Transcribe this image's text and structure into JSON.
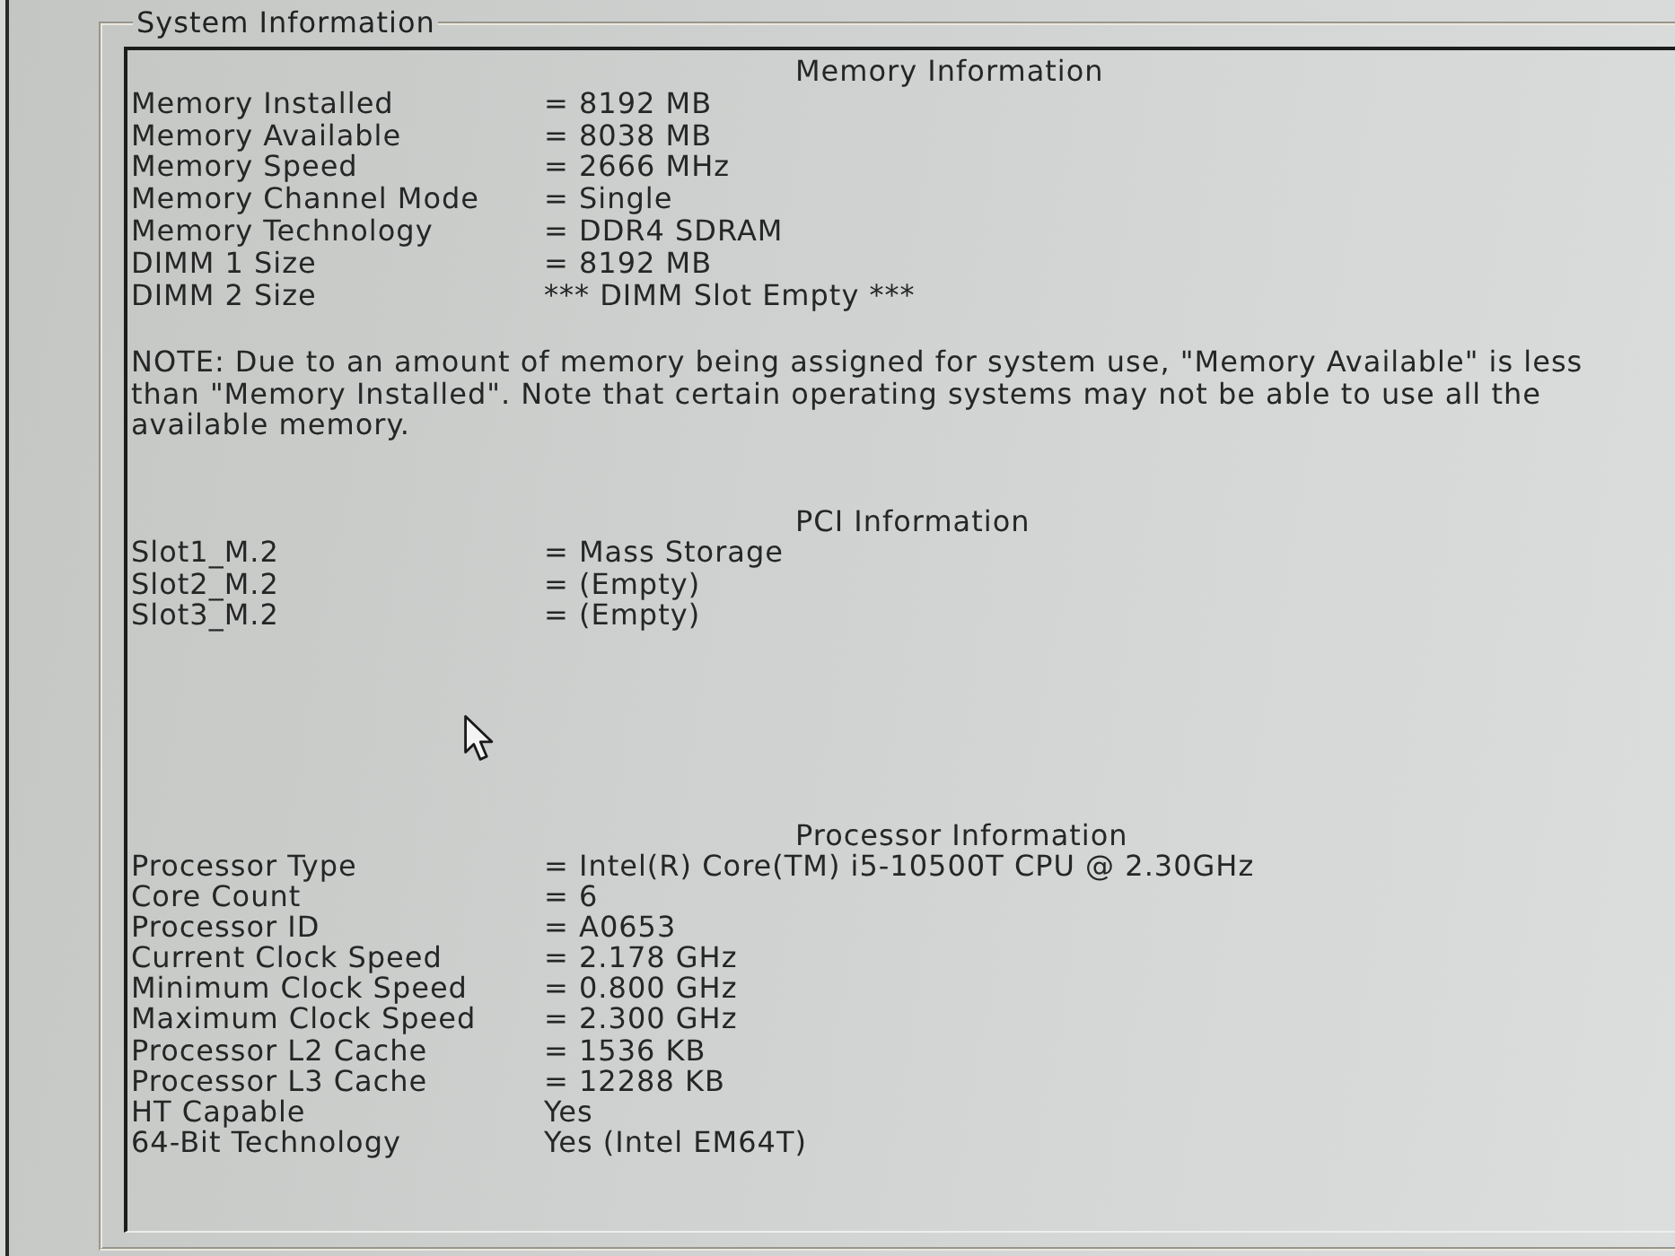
{
  "group": {
    "title": "System Information"
  },
  "sections": [
    {
      "heading": "Memory Information",
      "rows": [
        {
          "label": "Memory Installed",
          "value": "= 8192 MB"
        },
        {
          "label": "Memory Available",
          "value": "= 8038 MB"
        },
        {
          "label": "Memory Speed",
          "value": "= 2666 MHz"
        },
        {
          "label": "Memory Channel Mode",
          "value": "= Single"
        },
        {
          "label": "Memory Technology",
          "value": "= DDR4 SDRAM"
        },
        {
          "label": "DIMM 1 Size",
          "value": "= 8192 MB"
        },
        {
          "label": "DIMM 2 Size",
          "value": "*** DIMM Slot Empty ***"
        }
      ],
      "note": "NOTE: Due to an amount of memory being assigned for system use, \"Memory Available\" is less than \"Memory Installed\". Note that certain operating systems may not be able to use all the available memory."
    },
    {
      "heading": "PCI Information",
      "rows": [
        {
          "label": "Slot1_M.2",
          "value": "= Mass Storage"
        },
        {
          "label": "Slot2_M.2",
          "value": "= (Empty)"
        },
        {
          "label": "Slot3_M.2",
          "value": "= (Empty)"
        }
      ]
    },
    {
      "heading": "Processor Information",
      "rows": [
        {
          "label": "Processor Type",
          "value": "= Intel(R) Core(TM) i5-10500T CPU @ 2.30GHz"
        },
        {
          "label": "Core Count",
          "value": "= 6"
        },
        {
          "label": "Processor ID",
          "value": "= A0653"
        },
        {
          "label": "Current Clock Speed",
          "value": "= 2.178 GHz"
        },
        {
          "label": "Minimum Clock Speed",
          "value": "= 0.800 GHz"
        },
        {
          "label": "Maximum Clock Speed",
          "value": "= 2.300 GHz"
        },
        {
          "label": "Processor L2 Cache",
          "value": "= 1536 KB"
        },
        {
          "label": "Processor L3 Cache",
          "value": "= 12288 KB"
        },
        {
          "label": "HT Capable",
          "value": "Yes"
        },
        {
          "label": "64-Bit Technology",
          "value": "Yes (Intel EM64T)"
        }
      ]
    }
  ]
}
